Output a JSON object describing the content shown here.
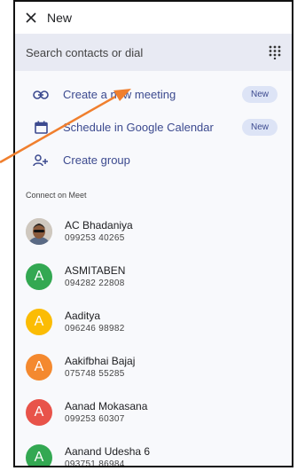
{
  "header": {
    "title": "New",
    "close_icon": "close-icon"
  },
  "search": {
    "placeholder": "Search contacts or dial",
    "dialpad_icon": "dialpad-icon"
  },
  "actions": [
    {
      "label": "Create a new meeting",
      "icon": "link-icon",
      "badge": "New"
    },
    {
      "label": "Schedule in Google Calendar",
      "icon": "calendar-icon",
      "badge": "New"
    },
    {
      "label": "Create group",
      "icon": "add-group-icon"
    }
  ],
  "section_label": "Connect on Meet",
  "contacts": [
    {
      "name": "AC Bhadaniya",
      "number": "099253 40265",
      "avatar_type": "photo"
    },
    {
      "name": "ASMITABEN",
      "number": "094282 22808",
      "initial": "A",
      "color": "#33a852"
    },
    {
      "name": "Aaditya",
      "number": "096246 98982",
      "initial": "A",
      "color": "#fbbc04"
    },
    {
      "name": "Aakifbhai Bajaj",
      "number": "075748 55285",
      "initial": "A",
      "color": "#f4892f"
    },
    {
      "name": "Aanad Mokasana",
      "number": "099253 60307",
      "initial": "A",
      "color": "#e8534a"
    },
    {
      "name": "Aanand Udesha 6",
      "number": "093751 86984",
      "initial": "A",
      "color": "#33a852"
    }
  ],
  "colors": {
    "accent": "#3c4a8f",
    "badge_bg": "#dde4f6",
    "annotation_arrow": "#f07f2e"
  }
}
